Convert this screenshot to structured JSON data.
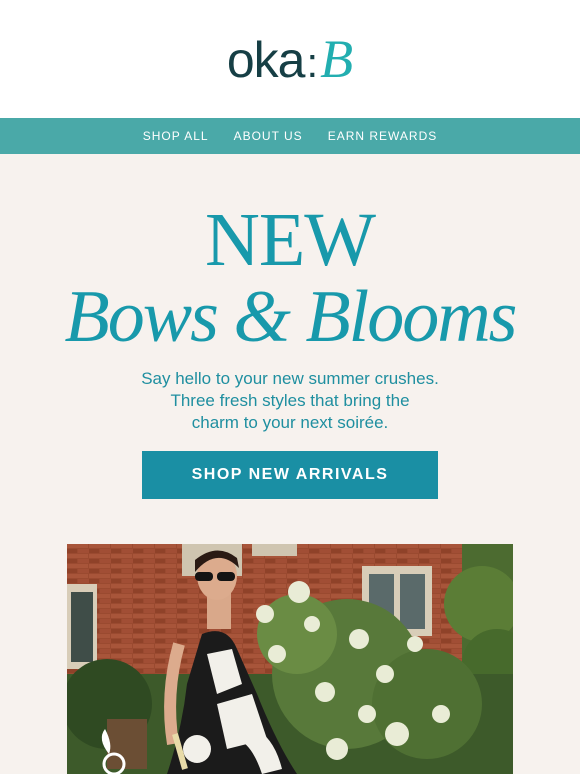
{
  "brand": {
    "logo_main": "oka",
    "logo_sep": ":",
    "logo_accent": "B"
  },
  "nav": {
    "items": [
      "SHOP ALL",
      "ABOUT US",
      "EARN REWARDS"
    ]
  },
  "hero": {
    "title_line1": "NEW",
    "title_line2": "Bows & Blooms",
    "subtitle_lines": [
      "Say hello to your new summer crushes.",
      "Three fresh styles that bring the",
      "charm to your next soirée."
    ],
    "cta_label": "SHOP NEW ARRIVALS"
  },
  "colors": {
    "teal_nav": "#4aa9a8",
    "teal_text": "#1899ab",
    "cta": "#1a8fa4",
    "logo_dark": "#163f45",
    "logo_accent": "#22aeb0",
    "hero_bg": "#f7f2ee"
  }
}
